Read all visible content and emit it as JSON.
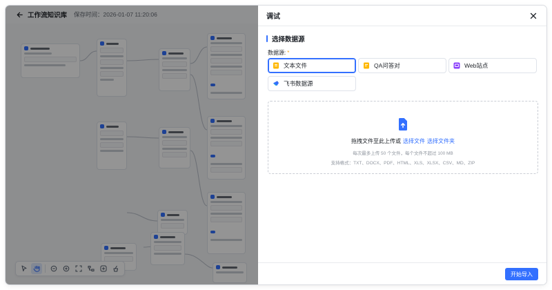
{
  "header": {
    "back_icon": "arrow-left-icon",
    "title": "工作流知识库",
    "save_time": "保存时间：2026-01-07 11:20:06"
  },
  "canvas_toolbar": {
    "tools": [
      "pointer-icon",
      "hand-icon",
      "zoom-out-icon",
      "zoom-in-icon",
      "fit-view-icon",
      "auto-layout-icon",
      "add-node-icon",
      "clean-icon"
    ]
  },
  "drawer": {
    "title": "调试",
    "close_icon": "close-icon",
    "section_title": "选择数据源",
    "datasource_label": "数据源:",
    "required_mark": "*",
    "options": [
      {
        "label": "文本文件",
        "icon": "text-file-icon",
        "color": "#ffb800",
        "selected": true
      },
      {
        "label": "QA问答对",
        "icon": "qa-file-icon",
        "color": "#ffb800",
        "selected": false
      },
      {
        "label": "Web站点",
        "icon": "web-site-icon",
        "color": "#8a3ffc",
        "selected": false
      },
      {
        "label": "飞书数据源",
        "icon": "feishu-icon",
        "color": "#3370ff",
        "selected": false
      }
    ],
    "upload": {
      "icon": "upload-file-icon",
      "main_text": "拖拽文件至此上传或",
      "select_file": "选择文件",
      "select_folder": "选择文件夹",
      "hint": "每次最多上传 50 个文件，每个文件不超过 100 MB",
      "formats": "支持格式：TXT、DOCX、PDF、HTML、XLS、XLSX、CSV、MD、ZIP"
    },
    "footer": {
      "primary_label": "开始导入"
    }
  },
  "colors": {
    "accent": "#3370ff",
    "mask": "rgba(0,0,0,0.42)"
  }
}
